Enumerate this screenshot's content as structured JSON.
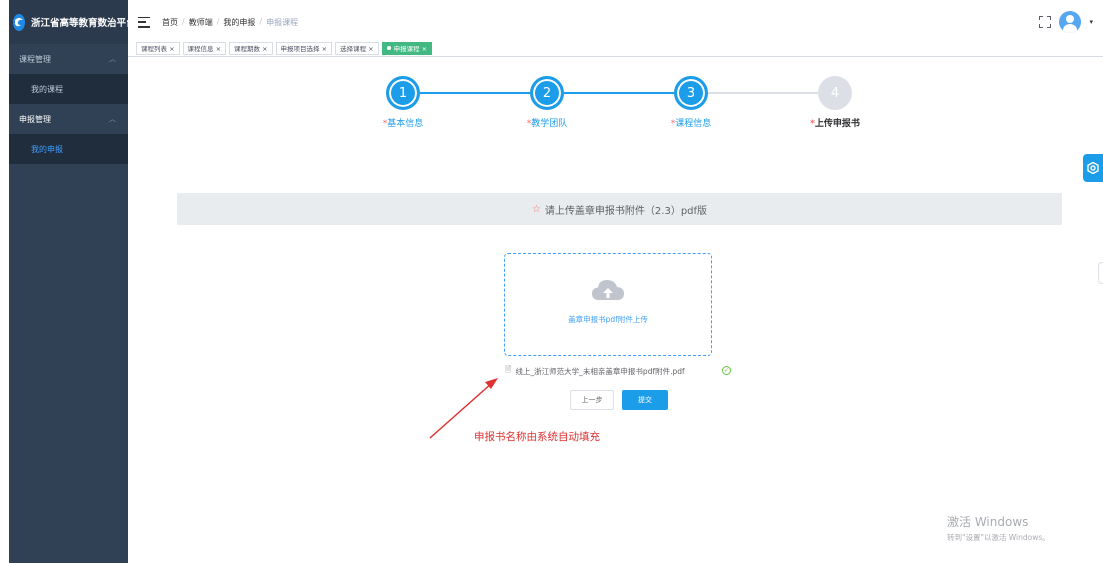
{
  "app": {
    "logo_text": "浙江省高等教育数治平台"
  },
  "sidebar": {
    "items": [
      {
        "type": "group",
        "label": "课程管理",
        "active": false
      },
      {
        "type": "item",
        "label": "我的课程",
        "active": false
      },
      {
        "type": "group",
        "label": "申报管理",
        "active": true
      },
      {
        "type": "item",
        "label": "我的申报",
        "active": true
      }
    ]
  },
  "breadcrumb": [
    "首页",
    "教师端",
    "我的申报",
    "申报课程"
  ],
  "tags": [
    {
      "label": "课程列表 ×",
      "active": false
    },
    {
      "label": "课程信息 ×",
      "active": false
    },
    {
      "label": "课程期数 ×",
      "active": false
    },
    {
      "label": "申报项目选择 ×",
      "active": false
    },
    {
      "label": "选择课程 ×",
      "active": false
    },
    {
      "label": "申报课程 ×",
      "active": true
    }
  ],
  "steps": [
    {
      "number": "1",
      "label": "基本信息",
      "required": "*",
      "done": true
    },
    {
      "number": "2",
      "label": "教学团队",
      "required": "*",
      "done": true
    },
    {
      "number": "3",
      "label": "课程信息",
      "required": "*",
      "done": true
    },
    {
      "number": "4",
      "label": "上传申报书",
      "required": "*",
      "done": false
    }
  ],
  "notice": {
    "star": "☆",
    "text": "请上传盖章申报书附件（2.3）pdf版"
  },
  "upload": {
    "label": "盖章申报书pdf附件上传",
    "file_name": "线上_浙江师范大学_未相亲盖章申报书pdf附件.pdf"
  },
  "buttons": {
    "prev": "上一步",
    "submit": "提交"
  },
  "annotation": {
    "text": "申报书名称由系统自动填充",
    "color": "#e03131"
  },
  "watermark": {
    "line1": "激活 Windows",
    "line2": "转到\"设置\"以激活 Windows。"
  },
  "colors": {
    "primary": "#1c9dea",
    "sidebar": "#304156",
    "tag_active": "#42b983"
  }
}
